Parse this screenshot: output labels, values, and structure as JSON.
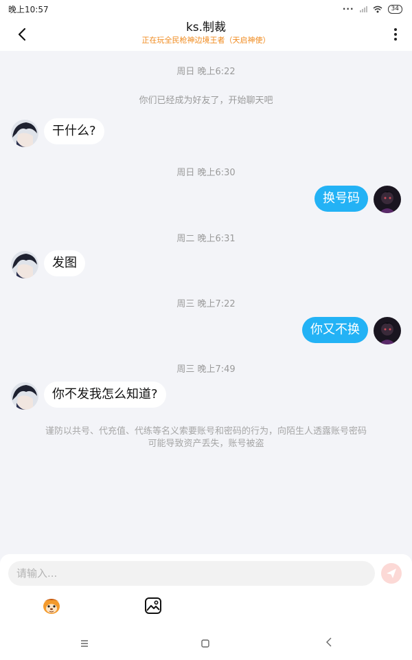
{
  "status_bar": {
    "time": "晚上10:57",
    "battery": "34"
  },
  "header": {
    "title": "ks.制裁",
    "subtitle": "正在玩全民枪神边境王者（天启神使）"
  },
  "messages": {
    "time_1": "周日 晚上6:22",
    "system_friend": "你们已经成为好友了，开始聊天吧",
    "msg_1": "干什么?",
    "time_2": "周日 晚上6:30",
    "msg_2": "换号码",
    "time_3": "周二 晚上6:31",
    "msg_3": "发图",
    "time_4": "周三 晚上7:22",
    "msg_4": "你又不换",
    "time_5": "周三 晚上7:49",
    "msg_5": "你不发我怎么知道?",
    "warning_line_1": "谨防以共号、代充值、代练等名义索要账号和密码的行为，向陌生人透露账号密码",
    "warning_line_2": "可能导致资产丢失，账号被盗"
  },
  "composer": {
    "placeholder": "请输入..."
  },
  "icons": {
    "back": "chevron-left-icon",
    "more": "more-vertical-icon",
    "send": "send-icon",
    "emoji": "emoji-icon",
    "image": "image-icon",
    "nav_menu": "menu-icon",
    "nav_home": "home-icon",
    "nav_back": "back-icon"
  },
  "colors": {
    "accent_blue": "#23b2f5",
    "subtitle_orange": "#f08a1d",
    "background": "#f3f4f8",
    "send_button": "#fcd9d6"
  }
}
